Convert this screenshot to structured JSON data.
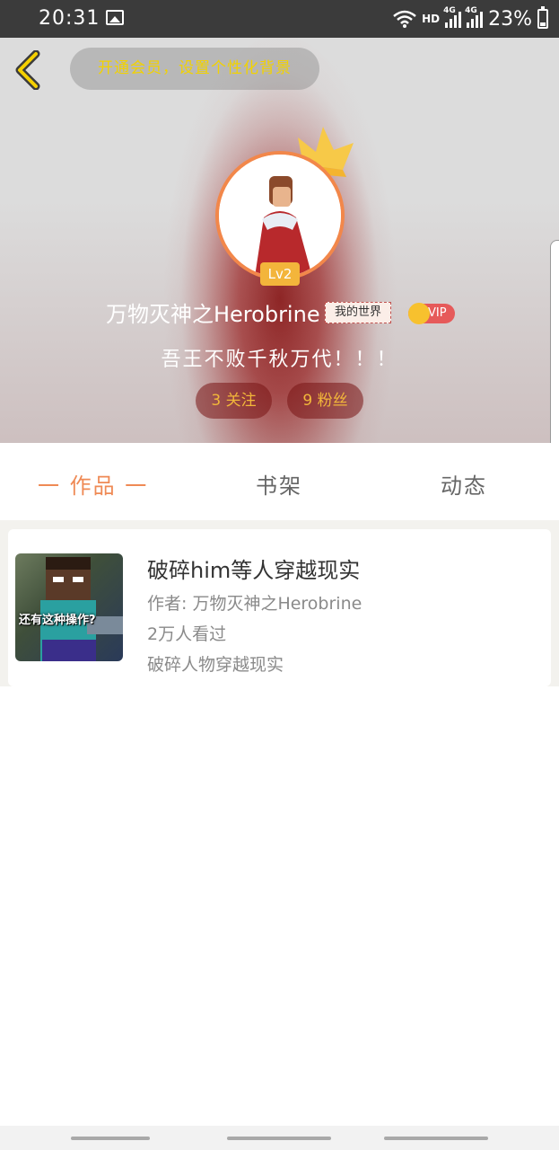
{
  "status_bar": {
    "time": "20:31",
    "network": "HD",
    "sim1": "4G",
    "sim2": "4G",
    "battery": "23%",
    "battery_level": 0.23
  },
  "header": {
    "back_icon": "chevron-left-icon",
    "vip_prompt": "开通会员，设置个性化背景",
    "level": "Lv2",
    "user_name": "万物灭神之Herobrine",
    "game_tag": "我的世界",
    "vip_label": "VIP",
    "signature": "吾王不败千秋万代！！！",
    "following": "3 关注",
    "followers": "9 粉丝",
    "accent_color": "#f2874a"
  },
  "tabs": [
    {
      "label": "一 作品 一",
      "active": true
    },
    {
      "label": "书架",
      "active": false
    },
    {
      "label": "动态",
      "active": false
    }
  ],
  "works": [
    {
      "cover_text": "还有这种操作?",
      "title": "破碎him等人穿越现实",
      "author": "作者: 万物灭神之Herobrine",
      "views": "2万人看过",
      "description": "破碎人物穿越现实"
    }
  ]
}
